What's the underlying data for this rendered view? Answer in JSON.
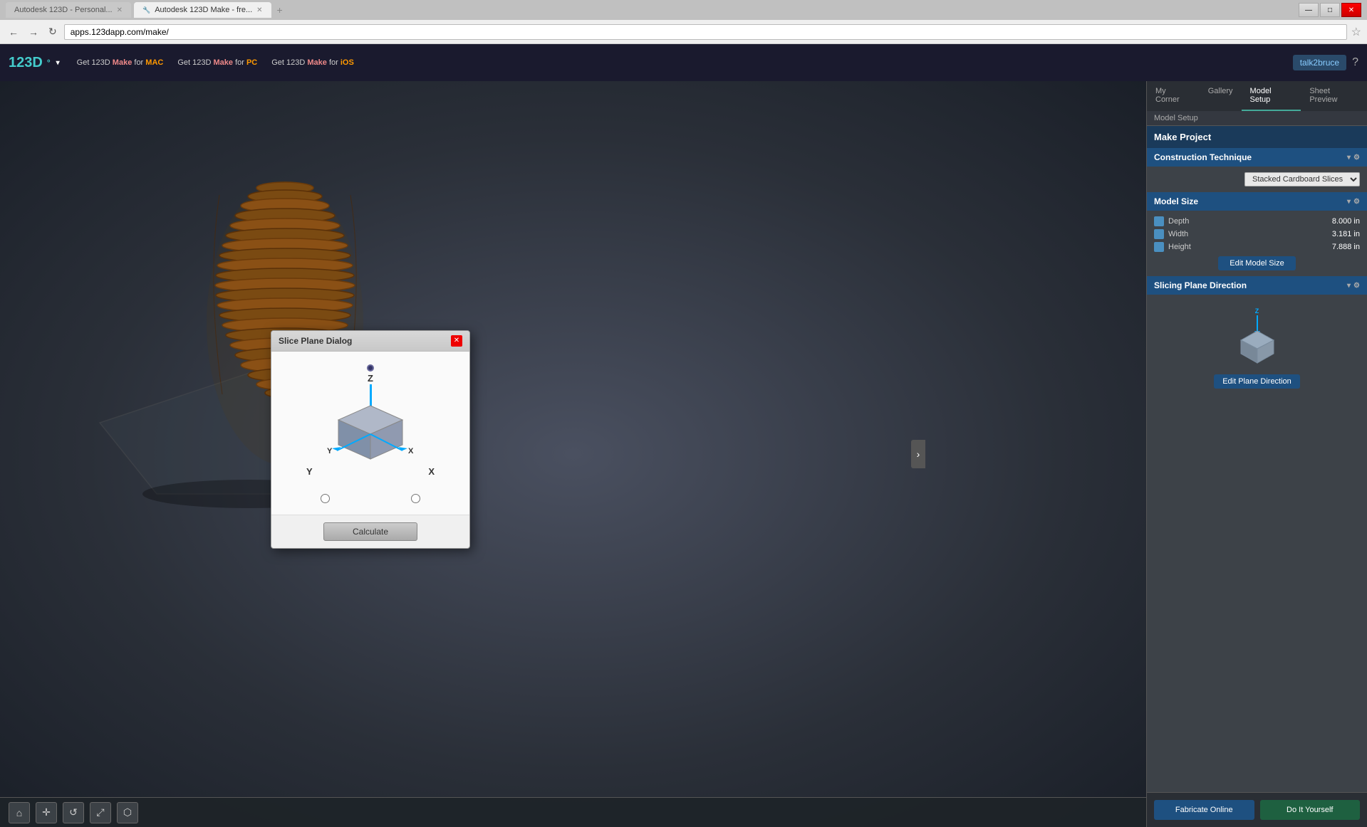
{
  "browser": {
    "tabs": [
      {
        "label": "Autodesk 123D - Personal...",
        "active": false
      },
      {
        "label": "Autodesk 123D Make - fre...",
        "active": true
      }
    ],
    "address": "apps.123dapp.com/make/",
    "window_controls": [
      "—",
      "□",
      "✕"
    ]
  },
  "app_header": {
    "logo": "123D",
    "logo_suffix": "°",
    "nav_items": [
      {
        "label": "Get 123D Make for MAC"
      },
      {
        "label": "Get 123D Make for PC"
      },
      {
        "label": "Get 123D Make for iOS"
      }
    ],
    "user": "talk2bruce",
    "help": "?"
  },
  "panel": {
    "tabs": [
      "My Corner",
      "Gallery",
      "Model Setup",
      "Sheet Preview"
    ],
    "active_tab": "Model Setup",
    "breadcrumb": "Model Setup",
    "make_project_title": "Make Project",
    "sections": {
      "construction_technique": {
        "title": "Construction Technique",
        "selected": "Stacked Cardboard Slices"
      },
      "model_size": {
        "title": "Model Size",
        "depth": "8.000 in",
        "width": "3.181 in",
        "height": "7.888 in",
        "edit_btn": "Edit Model Size"
      },
      "slicing_plane": {
        "title": "Slicing Plane Direction",
        "edit_btn": "Edit Plane Direction",
        "axis_label": "Z"
      }
    },
    "bottom_btns": {
      "fabricate": "Fabricate Online",
      "diy": "Do It Yourself"
    }
  },
  "dialog": {
    "title": "Slice Plane Dialog",
    "axis_labels": {
      "z": "Z",
      "y": "Y",
      "x": "X"
    },
    "radio_options": [
      "",
      ""
    ],
    "calculate_btn": "Calculate"
  },
  "toolbar": {
    "tools": [
      "⌂",
      "✛",
      "☚",
      "⬆",
      "⬡"
    ]
  },
  "colors": {
    "accent_blue": "#1e5080",
    "accent_green": "#1e6040",
    "arrow_blue": "#0af"
  }
}
